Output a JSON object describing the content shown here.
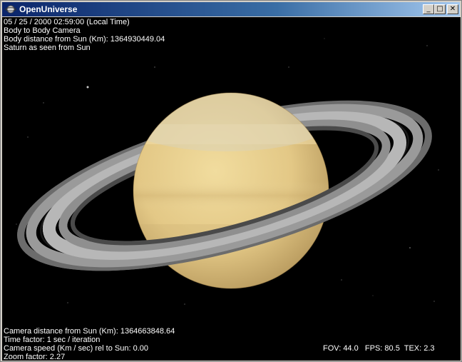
{
  "window": {
    "title": "OpenUniverse",
    "icon": "openuniverse-app-icon",
    "buttons": {
      "minimize_icon": "minimize-icon",
      "minimize_glyph": "_",
      "maximize_icon": "maximize-icon",
      "maximize_glyph": "□",
      "close_icon": "close-icon",
      "close_glyph": "✕"
    }
  },
  "hud_top": {
    "datetime": "05 / 25 / 2000  02:59:00 (Local Time)",
    "camera_mode": "Body to Body Camera",
    "body_distance": "Body distance from Sun (Km): 1364930449.04",
    "view_description": "Saturn as seen from Sun"
  },
  "hud_bottom": {
    "camera_distance": "Camera distance from Sun (Km): 1364663848.64",
    "time_factor": "Time factor: 1 sec / iteration",
    "camera_speed": "Camera speed (Km / sec) rel to Sun: 0.00",
    "zoom_factor": "Zoom factor: 2.27"
  },
  "hud_right": {
    "stats": "FOV: 44.0   FPS: 80.5  TEX: 2.3"
  },
  "scene": {
    "body": "Saturn",
    "background_color": "#000000",
    "planet_color": "#e8cf8a",
    "ring_color": "#8a8a8a"
  }
}
